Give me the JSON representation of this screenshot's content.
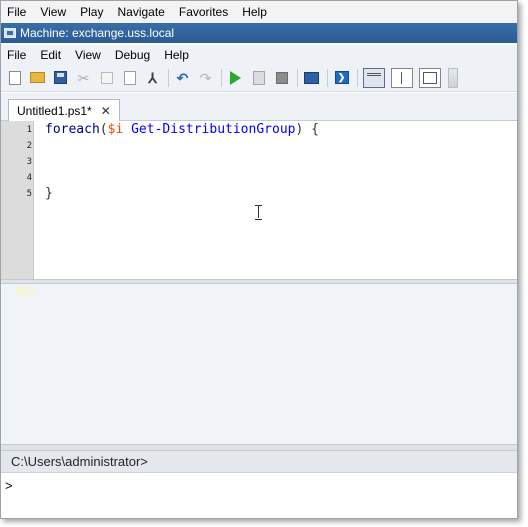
{
  "host_menu": [
    "File",
    "View",
    "Play",
    "Navigate",
    "Favorites",
    "Help"
  ],
  "window": {
    "title": "Machine: exchange.uss.local"
  },
  "app_menu": [
    "File",
    "Edit",
    "View",
    "Debug",
    "Help"
  ],
  "toolbar": {
    "icons": [
      "new-icon",
      "open-icon",
      "save-icon",
      "cut-icon",
      "copy-icon",
      "paste-icon",
      "clear-icon",
      "undo-icon",
      "redo-icon",
      "run-icon",
      "run-selection-icon",
      "stop-icon",
      "remote-tab-icon",
      "powershell-icon",
      "layout-top-icon",
      "layout-right-icon",
      "layout-max-icon"
    ]
  },
  "tab": {
    "label": "Untitled1.ps1*",
    "close": "✕"
  },
  "editor": {
    "line_numbers": [
      "1",
      "2",
      "3",
      "4",
      "5"
    ],
    "line1": {
      "kw": "foreach",
      "open": "(",
      "var": "$i",
      "sp": " ",
      "cmd": "Get-DistributionGroup",
      "close": ") {"
    },
    "line5": "}"
  },
  "output": {
    "text": "PS>"
  },
  "command": {
    "prompt": "C:\\Users\\administrator>",
    "input_value": ">"
  },
  "colors": {
    "titlebar": "#2b5b93",
    "keyword": "#00008b",
    "variable": "#ff4500",
    "cmdlet": "#0000ff",
    "run": "#2aa830"
  }
}
